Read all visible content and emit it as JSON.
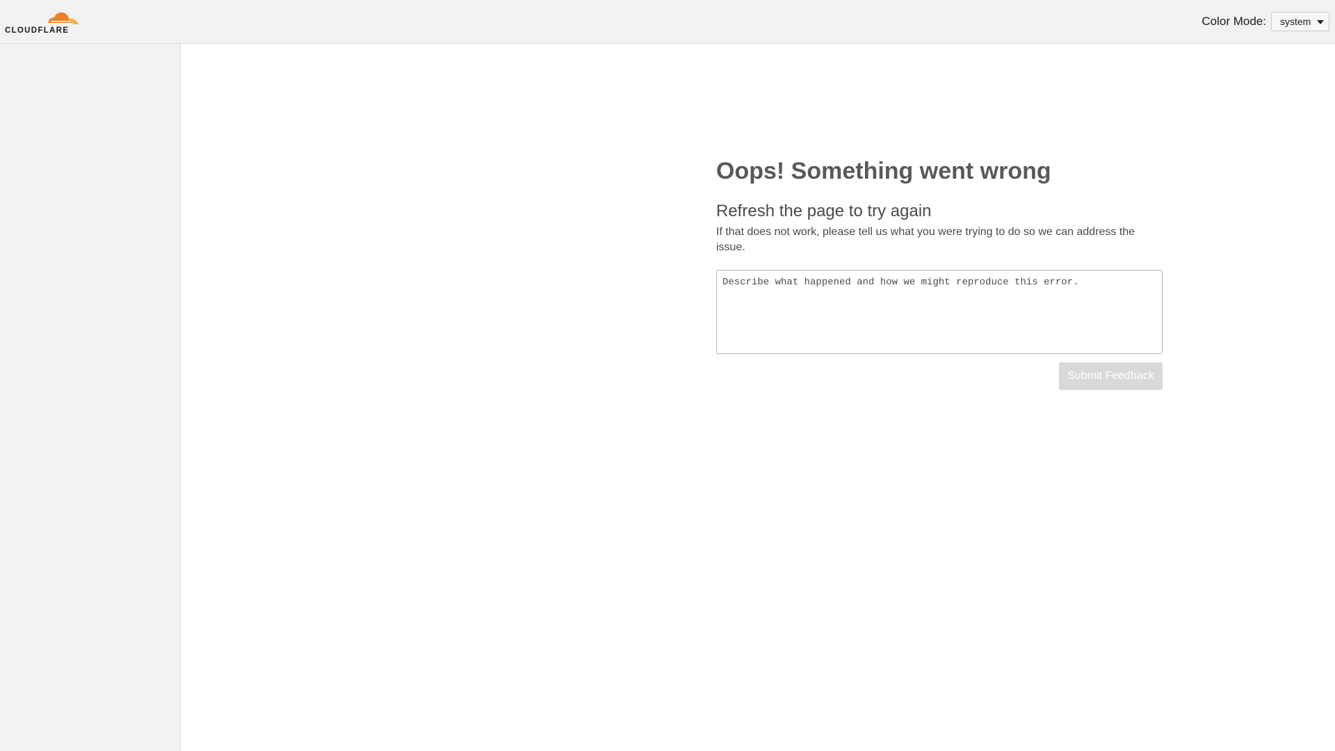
{
  "header": {
    "logo_text": "CLOUDFLARE",
    "brand_colors": {
      "orange": "#f38020",
      "light_orange": "#faae40"
    },
    "color_mode": {
      "label": "Color Mode:",
      "selected": "system"
    }
  },
  "error": {
    "title": "Oops! Something went wrong",
    "subtitle": "Refresh the page to try again",
    "description": "If that does not work, please tell us what you were trying to do so we can address the issue.",
    "feedback_placeholder": "Describe what happened and how we might reproduce this error.",
    "submit_label": "Submit Feedback"
  }
}
